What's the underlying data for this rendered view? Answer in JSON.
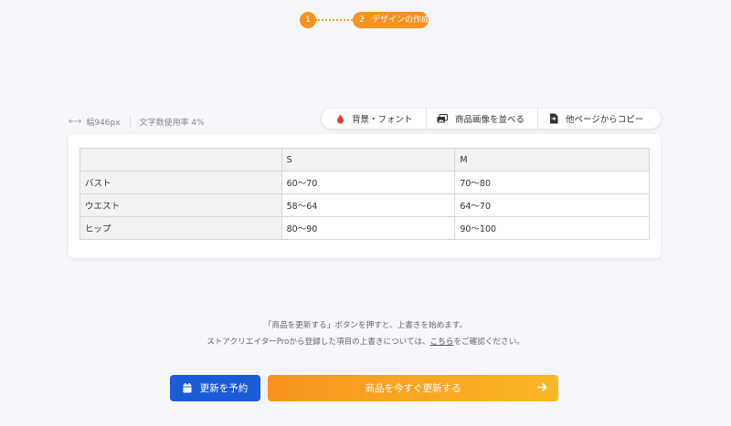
{
  "stepper": {
    "step1_number": "1",
    "step2_number": "2",
    "step2_label": "デザインの作成",
    "accent_color": "#f7931e"
  },
  "info": {
    "width_label": "幅946px",
    "char_usage_label": "文字数使用率 4%"
  },
  "toolbar": {
    "background_font_label": "背景・フォント",
    "arrange_images_label": "商品画像を並べる",
    "copy_from_page_label": "他ページからコピー"
  },
  "table": {
    "headers": [
      "",
      "S",
      "M"
    ],
    "rows": [
      {
        "label": "バスト",
        "s": "60〜70",
        "m": "70〜80"
      },
      {
        "label": "ウエスト",
        "s": "58〜64",
        "m": "64〜70"
      },
      {
        "label": "ヒップ",
        "s": "80〜90",
        "m": "90〜100"
      }
    ]
  },
  "notice": {
    "line1": "「商品を更新する」ボタンを押すと、上書きを始めます。",
    "line2_prefix": "ストアクリエイターProから登録した項目の上書きについては、",
    "line2_link": "こちら",
    "line2_suffix": "をご確認ください。"
  },
  "actions": {
    "schedule_label": "更新を予約",
    "update_now_label": "商品を今すぐ更新する",
    "schedule_color": "#1a5bd8"
  }
}
